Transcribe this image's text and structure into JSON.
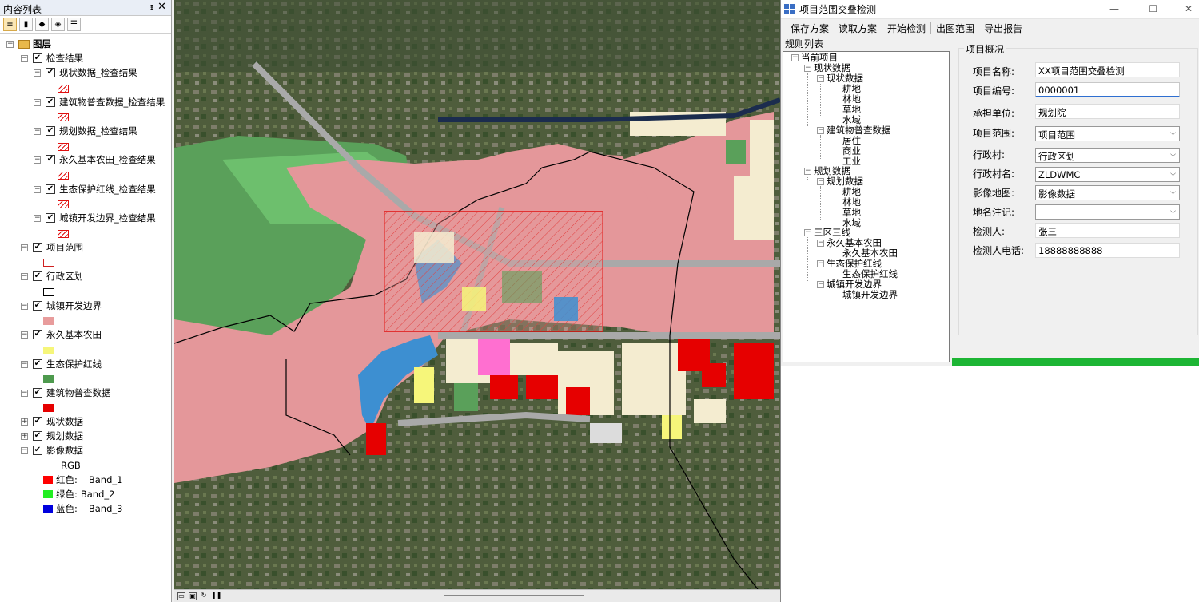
{
  "toc": {
    "title": "内容列表",
    "pin": "ᵻ",
    "close": "✕",
    "root": "图层",
    "check_results": {
      "label": "检查结果",
      "children": [
        "现状数据_检查结果",
        "建筑物普查数据_检查结果",
        "规划数据_检查结果",
        "永久基本农田_检查结果",
        "生态保护红线_检查结果",
        "城镇开发边界_检查结果"
      ]
    },
    "layers": [
      {
        "label": "项目范围"
      },
      {
        "label": "行政区划"
      },
      {
        "label": "城镇开发边界",
        "color": "#e89c9c"
      },
      {
        "label": "永久基本农田",
        "color": "#f6f67a"
      },
      {
        "label": "生态保护红线",
        "color": "#4e9a4e"
      },
      {
        "label": "建筑物普查数据",
        "color": "#e60000"
      }
    ],
    "collapsed": [
      "现状数据",
      "规划数据",
      "影像数据"
    ],
    "rgb": {
      "label": "RGB",
      "bands": [
        {
          "name": "红色:",
          "band": "Band_1",
          "color": "#ff0000"
        },
        {
          "name": "绿色:",
          "band": "Band_2",
          "color": "#22ee22"
        },
        {
          "name": "蓝色:",
          "band": "Band_3",
          "color": "#0000dd"
        }
      ]
    }
  },
  "dialog": {
    "title": "项目范围交叠检测",
    "minimize": "—",
    "maximize": "☐",
    "close": "✕",
    "menu": [
      "保存方案",
      "读取方案",
      "开始检测",
      "出图范围",
      "导出报告"
    ],
    "rules_label": "规则列表",
    "tree": {
      "root": "当前项目",
      "n1": "现状数据",
      "n1a": "现状数据",
      "n1a_items": [
        "耕地",
        "林地",
        "草地",
        "水域"
      ],
      "n1b": "建筑物普查数据",
      "n1b_items": [
        "居住",
        "商业",
        "工业"
      ],
      "n2": "规划数据",
      "n2a": "规划数据",
      "n2a_items": [
        "耕地",
        "林地",
        "草地",
        "水域"
      ],
      "n3": "三区三线",
      "n3a": "永久基本农田",
      "n3a_item": "永久基本农田",
      "n3b": "生态保护红线",
      "n3b_item": "生态保护红线",
      "n3c": "城镇开发边界",
      "n3c_item": "城镇开发边界"
    },
    "group_title": "项目概况",
    "fields": {
      "name_label": "项目名称:",
      "name_value": "XX项目范围交叠检测",
      "code_label": "项目编号:",
      "code_value": "0000001",
      "unit_label": "承担单位:",
      "unit_value": "规划院",
      "range_label": "项目范围:",
      "range_value": "项目范围",
      "village_label": "行政村:",
      "village_value": "行政区划",
      "vname_label": "行政村名:",
      "vname_value": "ZLDWMC",
      "image_label": "影像地图:",
      "image_value": "影像数据",
      "place_label": "地名注记:",
      "place_value": "",
      "inspector_label": "检测人:",
      "inspector_value": "张三",
      "phone_label": "检测人电话:",
      "phone_value": "18888888888"
    },
    "progress": 1.0
  }
}
